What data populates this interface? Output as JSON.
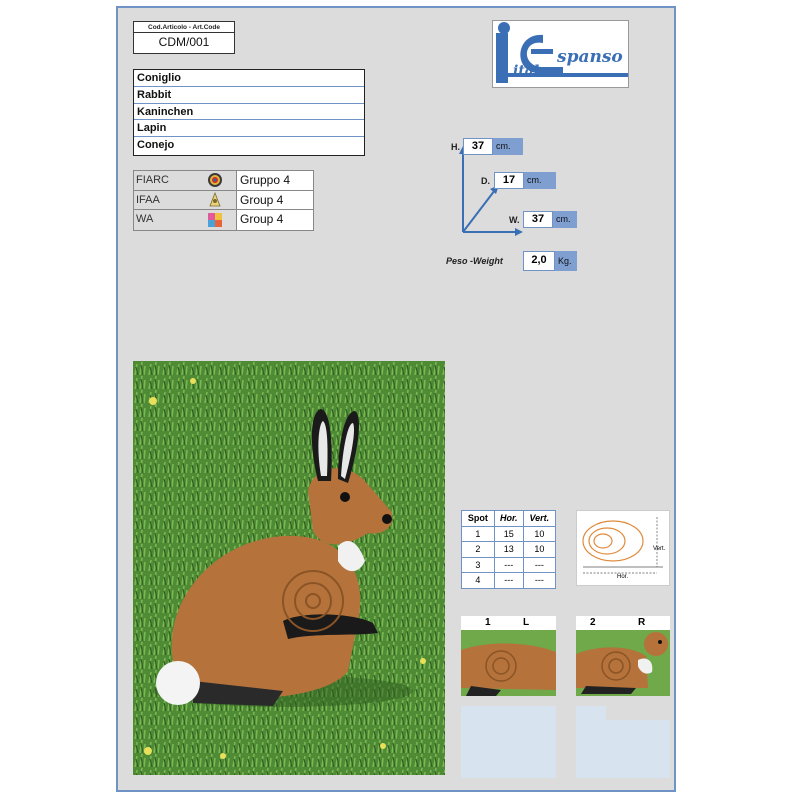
{
  "article": {
    "label": "Cod.Articolo - Art.Code",
    "code": "CDM/001"
  },
  "names": [
    "Coniglio",
    "Rabbit",
    "Kaninchen",
    "Lapin",
    "Conejo"
  ],
  "associations": [
    {
      "name": "FIARC",
      "group": "Gruppo 4",
      "icon": "fiarc-logo-icon"
    },
    {
      "name": "IFAA",
      "group": "Group 4",
      "icon": "ifaa-logo-icon"
    },
    {
      "name": "WA",
      "group": "Group 4",
      "icon": "wa-logo-icon"
    }
  ],
  "logo": {
    "letter_i": "i",
    "letter_e": "e",
    "text1": "spanso",
    "text2": "ital"
  },
  "dimensions": {
    "h_label": "H.",
    "h_value": "37",
    "h_unit": "cm.",
    "d_label": "D.",
    "d_value": "17",
    "d_unit": "cm.",
    "w_label": "W.",
    "w_value": "37",
    "w_unit": "cm."
  },
  "weight": {
    "label": "Peso -Weight",
    "value": "2,0",
    "unit": "Kg."
  },
  "spots": {
    "headers": [
      "Spot",
      "Hor.",
      "Vert."
    ],
    "rows": [
      [
        "1",
        "15",
        "10"
      ],
      [
        "2",
        "13",
        "10"
      ],
      [
        "3",
        "---",
        "---"
      ],
      [
        "4",
        "---",
        "---"
      ]
    ]
  },
  "diagram": {
    "vert_label": "Vert.",
    "hor_label": "Hor."
  },
  "thumbnails": [
    {
      "number": "1",
      "side": "L"
    },
    {
      "number": "2",
      "side": "R"
    }
  ],
  "colors": {
    "accent_blue": "#6f93c6",
    "unit_blue": "#7f9fd1",
    "sheet_gray": "#dcdcdd",
    "logo_blue": "#3a6fb5"
  }
}
